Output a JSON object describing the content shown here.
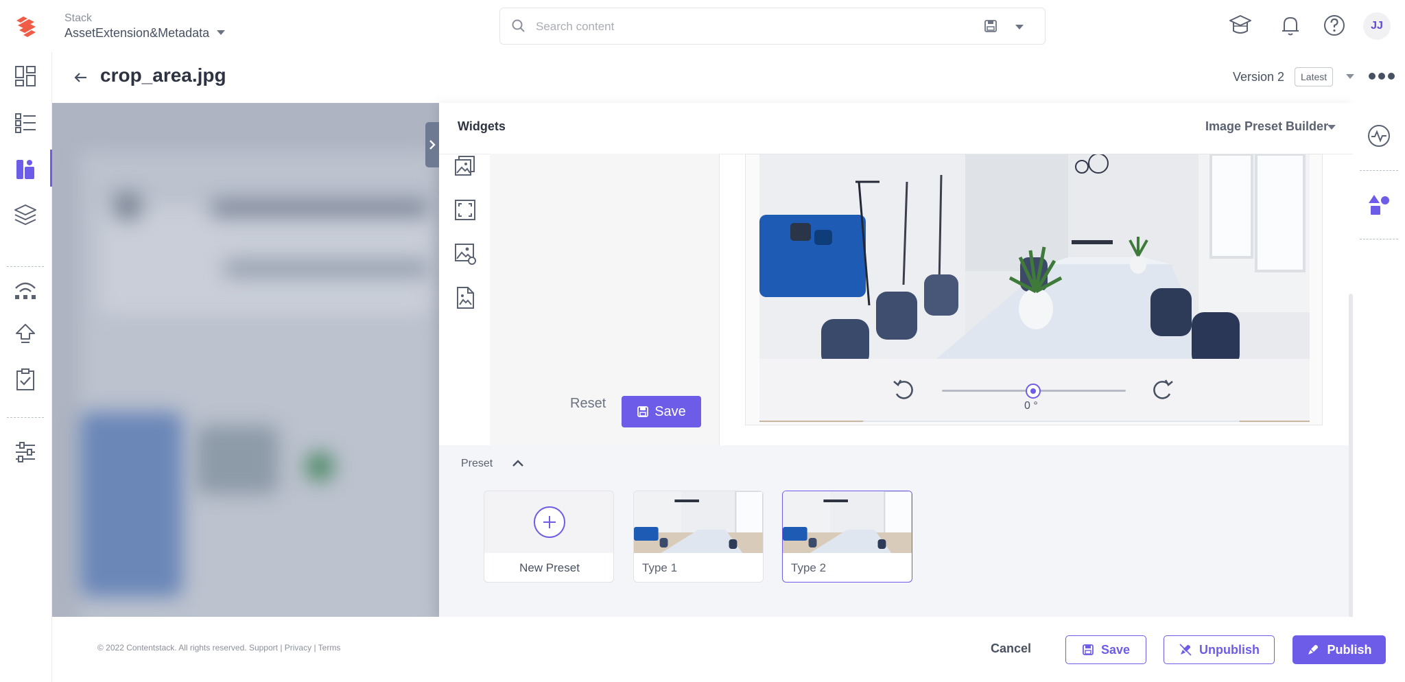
{
  "header": {
    "stack_label": "Stack",
    "stack_name": "AssetExtension&Metadata",
    "search_placeholder": "Search content",
    "avatar_initials": "JJ",
    "icons": [
      "logo-icon",
      "search-icon",
      "saved-search-icon",
      "academy-icon",
      "bell-icon",
      "help-icon"
    ]
  },
  "leftnav": {
    "items": [
      "dashboard-icon",
      "entries-icon",
      "assets-icon",
      "content-models-icon",
      "extensions-icon",
      "deploy-icon",
      "tasks-icon",
      "settings-icon"
    ],
    "active": "assets-icon"
  },
  "title_row": {
    "title": "crop_area.jpg",
    "version_label": "Version 2",
    "latest_badge": "Latest"
  },
  "widgets": {
    "title": "Widgets",
    "builder_select": "Image Preset Builder",
    "tools": [
      "image-icon",
      "crop-frame-icon",
      "image-settings-icon",
      "image-file-icon"
    ],
    "reset_label": "Reset",
    "save_label": "Save",
    "rotation_value": "0 °",
    "rotation_level": 0.5,
    "preset_label": "Preset",
    "presets": [
      {
        "name": "New Preset"
      },
      {
        "name": "Type 1"
      },
      {
        "name": "Type 2"
      }
    ],
    "selected_preset": "Type 2"
  },
  "footer": {
    "copyright": "© 2022 Contentstack. All rights reserved. Support | Privacy | Terms",
    "cancel_label": "Cancel",
    "save_label": "Save",
    "unpublish_label": "Unpublish",
    "publish_label": "Publish"
  },
  "right_rail": {
    "icons": [
      "activity-icon",
      "shapes-icon"
    ]
  },
  "colors": {
    "accent": "#6c5ce7",
    "text_dark": "#2d3340",
    "text_muted": "#8a8f9c"
  }
}
